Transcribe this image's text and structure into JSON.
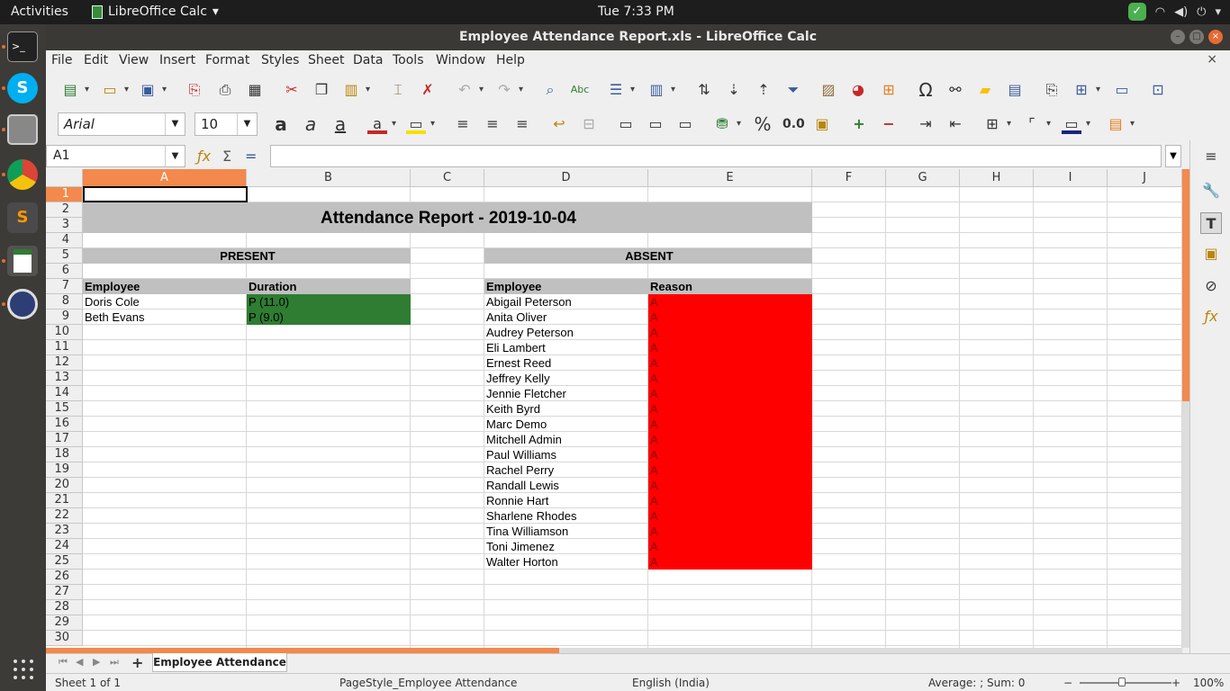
{
  "topbar": {
    "activities": "Activities",
    "app_name": "LibreOffice Calc",
    "clock": "Tue  7:33 PM"
  },
  "window": {
    "title": "Employee Attendance Report.xls - LibreOffice Calc"
  },
  "menu": [
    "File",
    "Edit",
    "View",
    "Insert",
    "Format",
    "Styles",
    "Sheet",
    "Data",
    "Tools",
    "Window",
    "Help"
  ],
  "toolbar": {
    "font_name": "Arial",
    "font_size": "10",
    "percent": "%",
    "decimal": "0.0"
  },
  "formula": {
    "cell_ref": "A1",
    "content": ""
  },
  "columns": [
    "A",
    "B",
    "C",
    "D",
    "E",
    "F",
    "G",
    "H",
    "I",
    "J"
  ],
  "rows": [
    "1",
    "2",
    "3",
    "4",
    "5",
    "6",
    "7",
    "8",
    "9",
    "10",
    "11",
    "12",
    "13",
    "14",
    "15",
    "16",
    "17",
    "18",
    "19",
    "20",
    "21",
    "22",
    "23",
    "24",
    "25",
    "26",
    "27",
    "28",
    "29",
    "30"
  ],
  "sheet": {
    "title": "Attendance Report - 2019-10-04",
    "present_header": "PRESENT",
    "absent_header": "ABSENT",
    "present_cols": [
      "Employee",
      "Duration"
    ],
    "absent_cols": [
      "Employee",
      "Reason"
    ],
    "present": [
      {
        "employee": "Doris Cole",
        "duration": "P (11.0)"
      },
      {
        "employee": "Beth Evans",
        "duration": "P (9.0)"
      }
    ],
    "absent": [
      {
        "employee": "Abigail Peterson",
        "reason": "A"
      },
      {
        "employee": "Anita Oliver",
        "reason": "A"
      },
      {
        "employee": "Audrey Peterson",
        "reason": "A"
      },
      {
        "employee": "Eli Lambert",
        "reason": "A"
      },
      {
        "employee": "Ernest Reed",
        "reason": "A"
      },
      {
        "employee": "Jeffrey Kelly",
        "reason": "A"
      },
      {
        "employee": "Jennie Fletcher",
        "reason": "A"
      },
      {
        "employee": "Keith Byrd",
        "reason": "A"
      },
      {
        "employee": "Marc Demo",
        "reason": "A"
      },
      {
        "employee": "Mitchell Admin",
        "reason": "A"
      },
      {
        "employee": "Paul Williams",
        "reason": "A"
      },
      {
        "employee": "Rachel Perry",
        "reason": "A"
      },
      {
        "employee": "Randall Lewis",
        "reason": "A"
      },
      {
        "employee": "Ronnie Hart",
        "reason": "A"
      },
      {
        "employee": "Sharlene Rhodes",
        "reason": "A"
      },
      {
        "employee": "Tina Williamson",
        "reason": "A"
      },
      {
        "employee": "Toni Jimenez",
        "reason": "A"
      },
      {
        "employee": "Walter Horton",
        "reason": "A"
      }
    ]
  },
  "tabs": {
    "active": "Employee Attendance"
  },
  "status": {
    "sheet": "Sheet 1 of 1",
    "page_style": "PageStyle_Employee Attendance",
    "language": "English (India)",
    "summary": "Average: ; Sum: 0",
    "zoom": "100%"
  },
  "colors": {
    "accent": "#f3894d",
    "present_fill": "#2e7d32",
    "absent_fill": "#ff0000",
    "header_fill": "#c0c0c0"
  }
}
